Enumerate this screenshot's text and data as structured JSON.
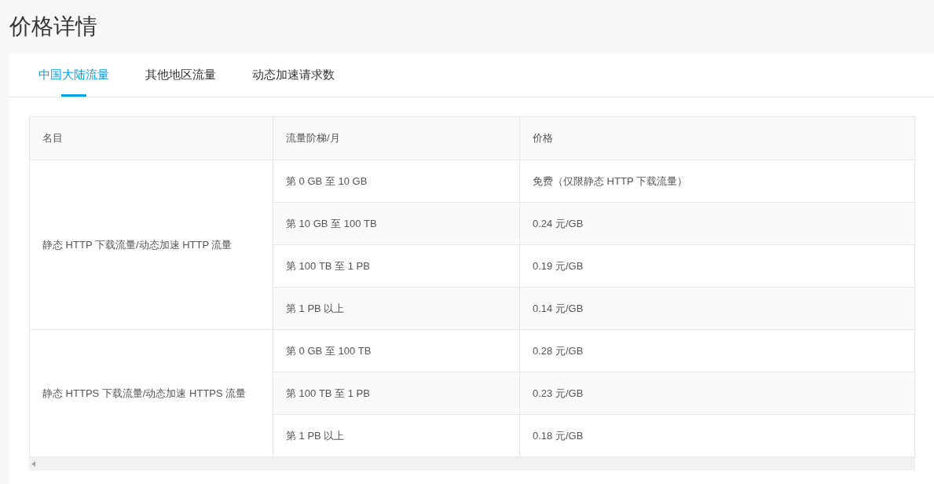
{
  "title": "价格详情",
  "tabs": [
    {
      "label": "中国大陆流量",
      "selected": true
    },
    {
      "label": "其他地区流量",
      "selected": false
    },
    {
      "label": "动态加速请求数",
      "selected": false
    }
  ],
  "table": {
    "columns": [
      "名目",
      "流量阶梯/月",
      "价格"
    ],
    "groups": [
      {
        "name": "静态 HTTP 下载流量/动态加速 HTTP 流量",
        "tiers": [
          {
            "range": "第 0 GB 至 10 GB",
            "price": "免费（仅限静态 HTTP 下载流量）"
          },
          {
            "range": "第 10 GB 至 100 TB",
            "price": "0.24 元/GB"
          },
          {
            "range": "第 100 TB 至 1 PB",
            "price": "0.19 元/GB"
          },
          {
            "range": "第 1 PB 以上",
            "price": "0.14 元/GB"
          }
        ]
      },
      {
        "name": "静态 HTTPS 下载流量/动态加速 HTTPS 流量",
        "tiers": [
          {
            "range": "第 0 GB 至 100 TB",
            "price": "0.28 元/GB"
          },
          {
            "range": "第 100 TB 至 1 PB",
            "price": "0.23 元/GB"
          },
          {
            "range": "第 1 PB 以上",
            "price": "0.18 元/GB"
          }
        ]
      }
    ]
  }
}
